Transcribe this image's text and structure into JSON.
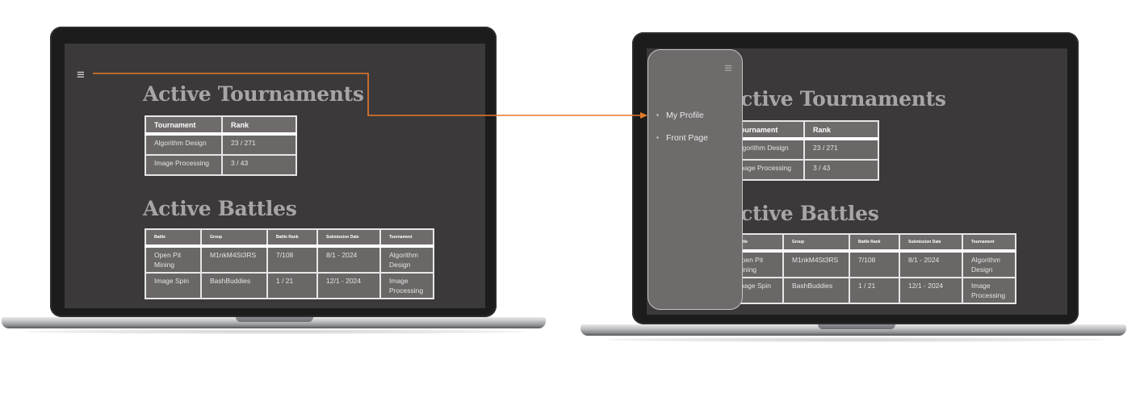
{
  "menu_icon": "hamburger-icon",
  "accent_color": "#e57a2c",
  "tournaments": {
    "title": "Active Tournaments",
    "columns": [
      "Tournament",
      "Rank"
    ],
    "rows": [
      [
        "Algorithm Design",
        "23 / 271"
      ],
      [
        "Image Processing",
        "3 / 43"
      ]
    ]
  },
  "battles": {
    "title": "Active Battles",
    "columns": [
      "Battle",
      "Group",
      "Battle Rank",
      "Submission Date",
      "Tournament"
    ],
    "rows": [
      [
        "Open Pit Mining",
        "M1nkM4St3RS",
        "7/108",
        "8/1 - 2024",
        "Algorithm Design"
      ],
      [
        "Image Spin",
        "BashBuddies",
        "1 / 21",
        "12/1 - 2024",
        "Image Processing"
      ]
    ]
  },
  "side_menu": {
    "items": [
      {
        "label": "My Profile"
      },
      {
        "label": "Front Page"
      }
    ]
  }
}
